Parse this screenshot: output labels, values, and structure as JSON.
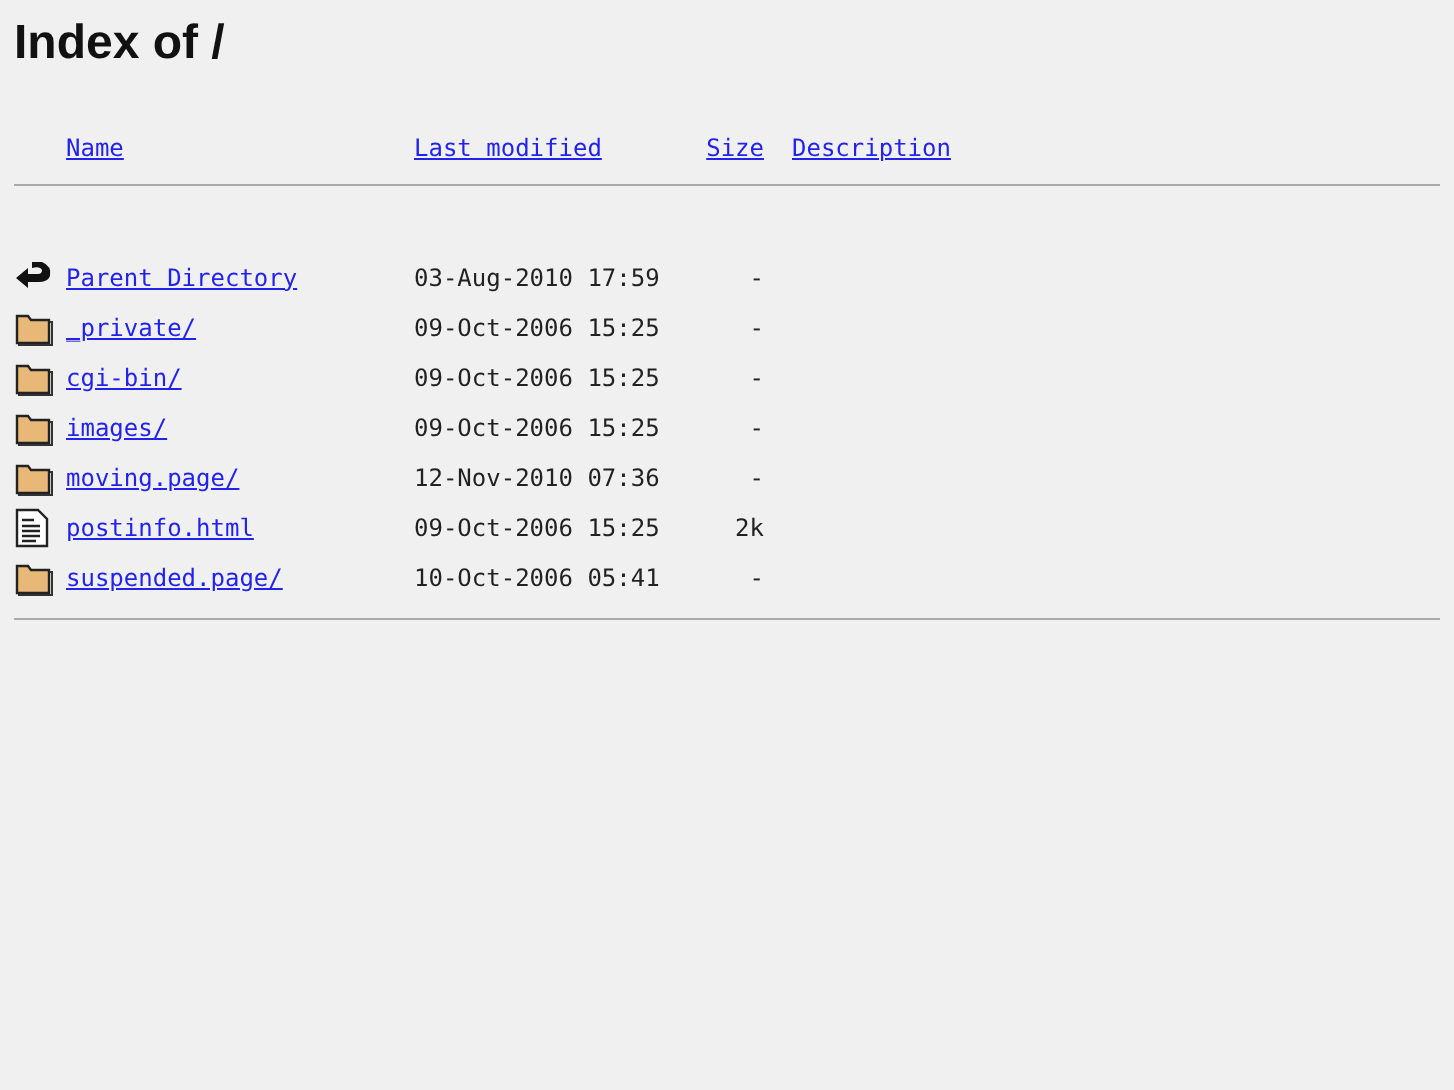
{
  "title": "Index of /",
  "columns": [
    "Name",
    "Last modified",
    "Size",
    "Description"
  ],
  "rows": [
    {
      "kind": "back",
      "name": "Parent Directory",
      "modified": "03-Aug-2010 17:59",
      "size": "-"
    },
    {
      "kind": "folder",
      "name": "_private/",
      "modified": "09-Oct-2006 15:25",
      "size": "-"
    },
    {
      "kind": "folder",
      "name": "cgi-bin/",
      "modified": "09-Oct-2006 15:25",
      "size": "-"
    },
    {
      "kind": "folder",
      "name": "images/",
      "modified": "09-Oct-2006 15:25",
      "size": "-"
    },
    {
      "kind": "folder",
      "name": "moving.page/",
      "modified": "12-Nov-2010 07:36",
      "size": "-"
    },
    {
      "kind": "file",
      "name": "postinfo.html",
      "modified": "09-Oct-2006 15:25",
      "size": "2k"
    },
    {
      "kind": "folder",
      "name": "suspended.page/",
      "modified": "10-Oct-2006 05:41",
      "size": "-"
    }
  ]
}
